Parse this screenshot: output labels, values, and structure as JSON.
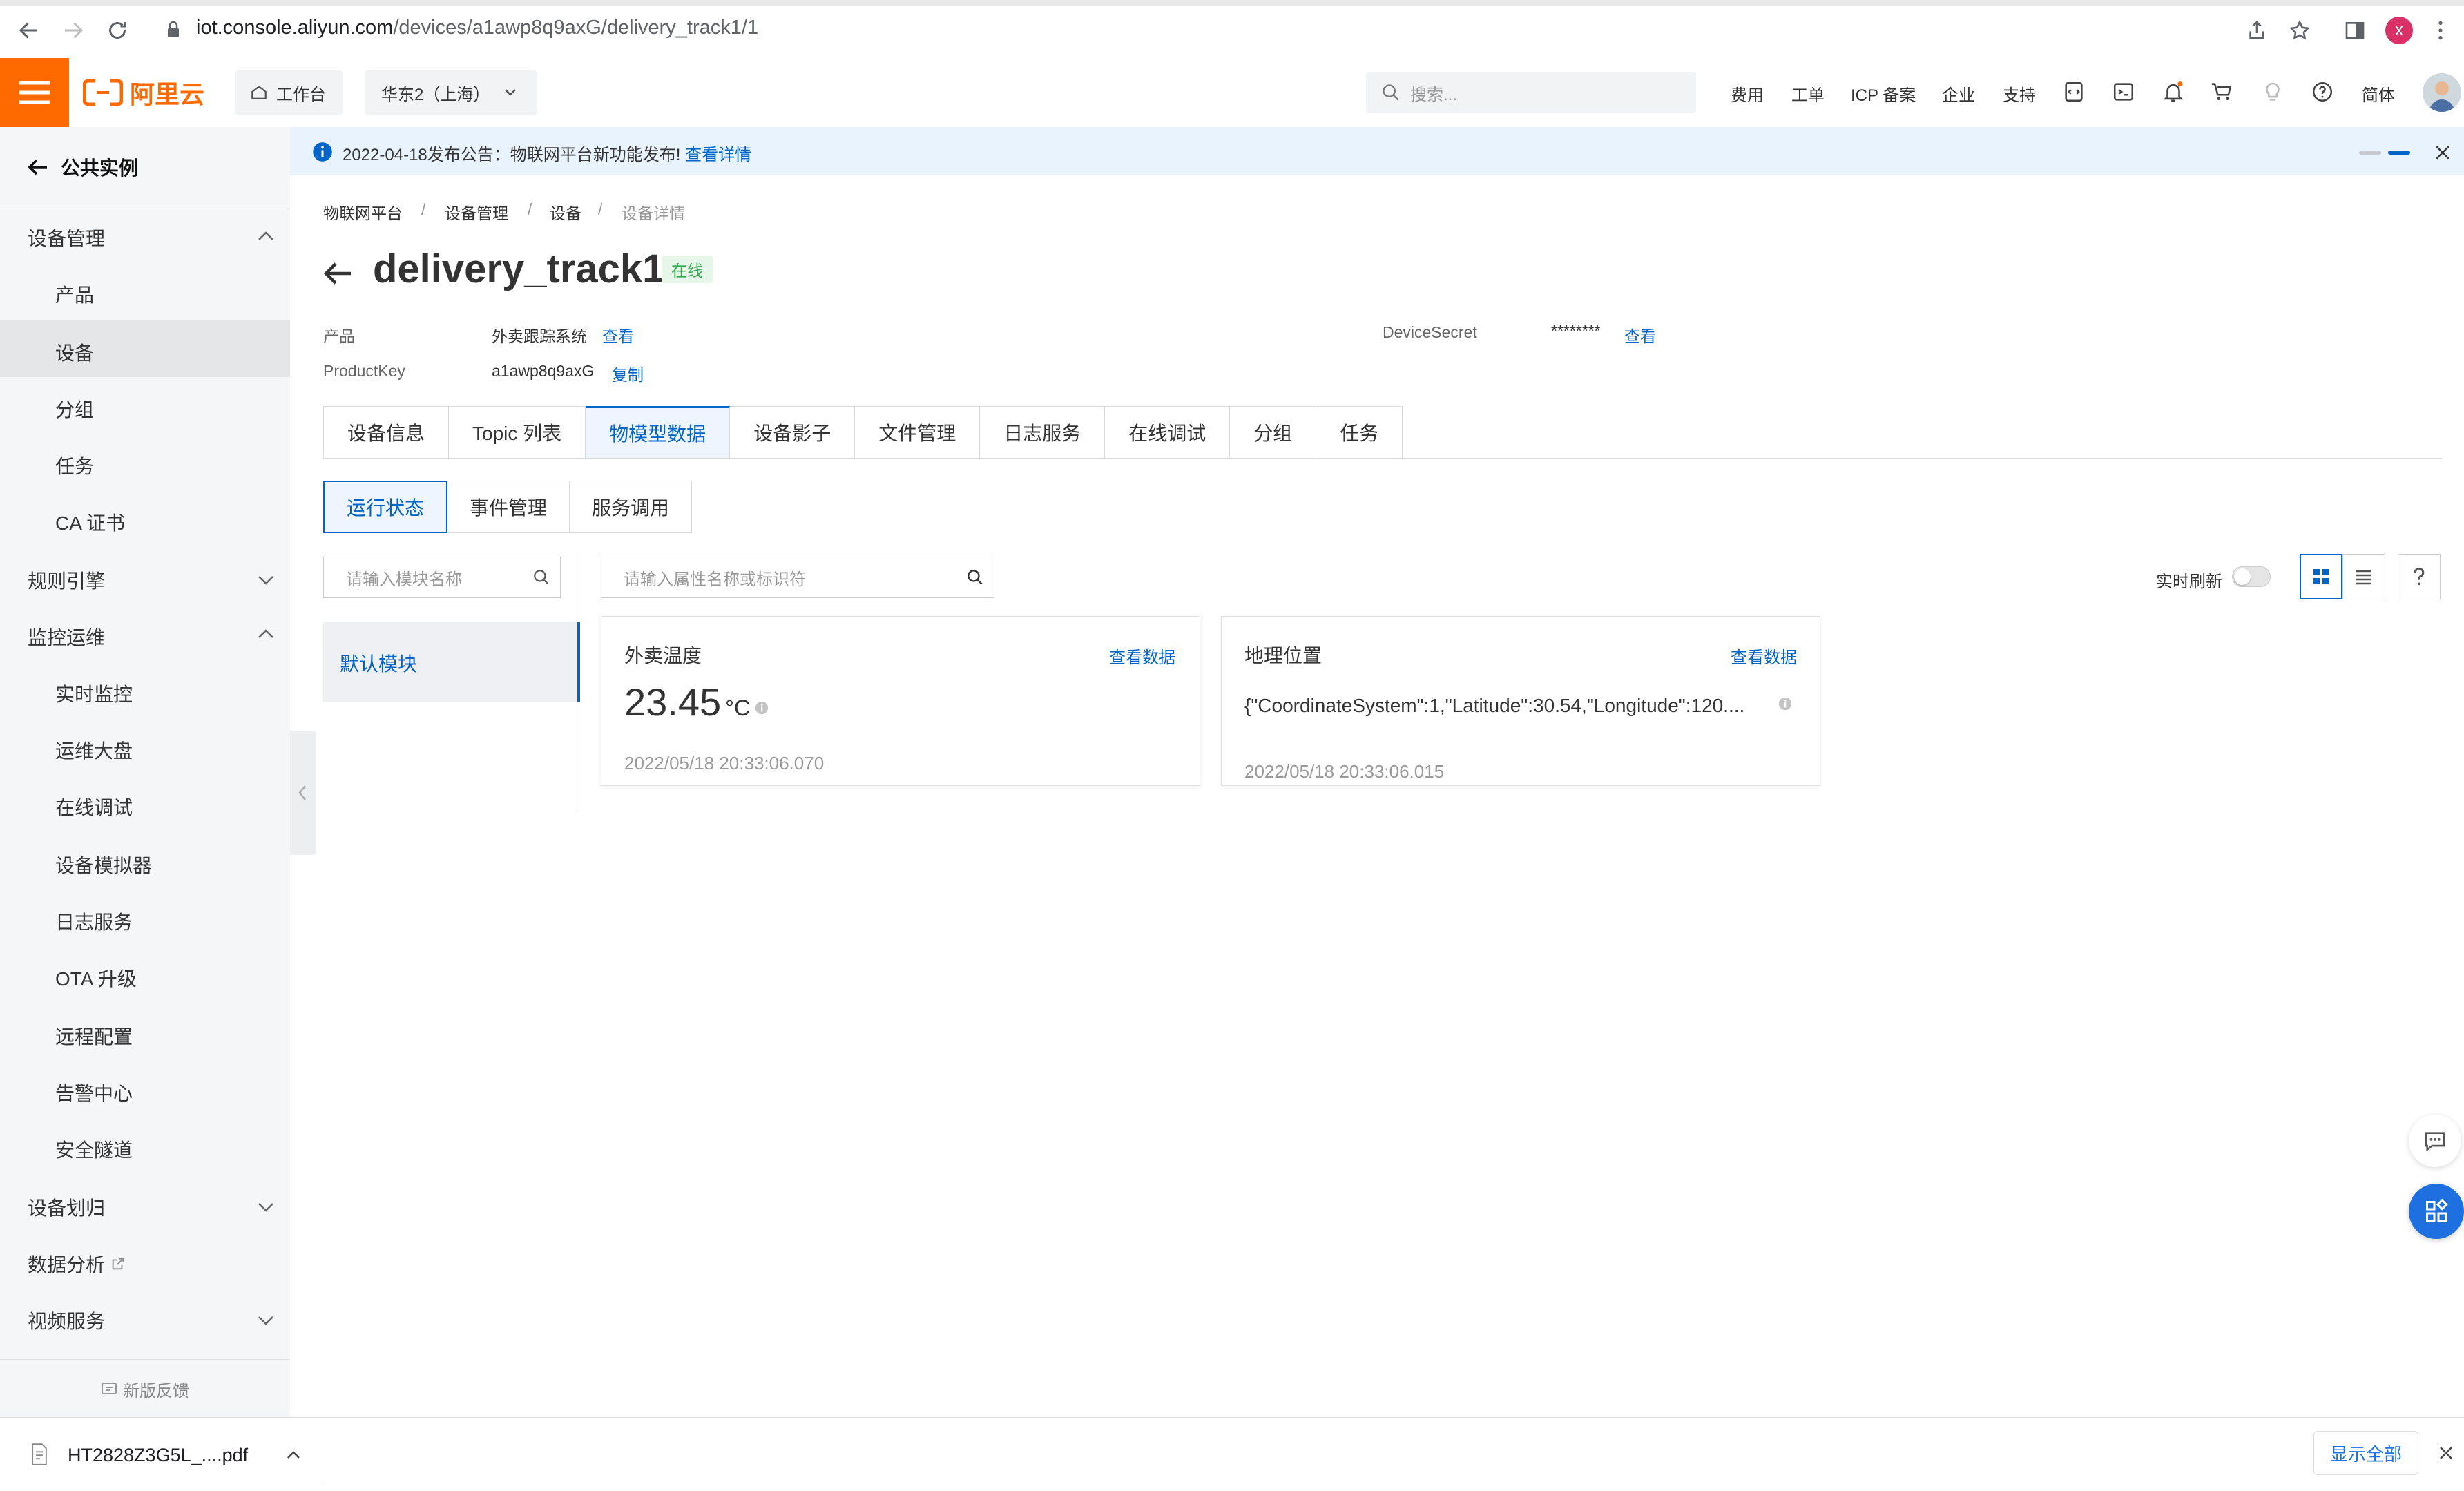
{
  "browser": {
    "url_host": "iot.console.aliyun.com",
    "url_path": "/devices/a1awp8q9axG/delivery_track1/1",
    "profile_initial": "x"
  },
  "header": {
    "logo_text": "阿里云",
    "workbench": "工作台",
    "region": "华东2（上海）",
    "search_placeholder": "搜索...",
    "links": [
      "费用",
      "工单",
      "ICP 备案",
      "企业",
      "支持"
    ],
    "lang": "简体"
  },
  "sidebar": {
    "back_label": "公共实例",
    "groups": [
      {
        "label": "设备管理",
        "expanded": true,
        "items": [
          "产品",
          "设备",
          "分组",
          "任务",
          "CA 证书"
        ],
        "active_item": "设备"
      },
      {
        "label": "规则引擎",
        "expanded": false
      },
      {
        "label": "监控运维",
        "expanded": true,
        "items": [
          "实时监控",
          "运维大盘",
          "在线调试",
          "设备模拟器",
          "日志服务",
          "OTA 升级",
          "远程配置",
          "告警中心",
          "安全隧道"
        ]
      },
      {
        "label": "设备划归",
        "expanded": false
      },
      {
        "label": "数据分析",
        "external": true
      },
      {
        "label": "视频服务",
        "expanded": false
      }
    ],
    "feedback": "新版反馈"
  },
  "announcement": {
    "text": "2022-04-18发布公告：物联网平台新功能发布!",
    "link": "查看详情"
  },
  "breadcrumb": [
    "物联网平台",
    "设备管理",
    "设备",
    "设备详情"
  ],
  "device": {
    "name": "delivery_track1",
    "status": "在线",
    "product_label": "产品",
    "product_value": "外卖跟踪系统",
    "product_link": "查看",
    "productkey_label": "ProductKey",
    "productkey_value": "a1awp8q9axG",
    "productkey_link": "复制",
    "secret_label": "DeviceSecret",
    "secret_value": "********",
    "secret_link": "查看"
  },
  "tabs": [
    "设备信息",
    "Topic 列表",
    "物模型数据",
    "设备影子",
    "文件管理",
    "日志服务",
    "在线调试",
    "分组",
    "任务"
  ],
  "active_tab": "物模型数据",
  "subtabs": [
    "运行状态",
    "事件管理",
    "服务调用"
  ],
  "active_subtab": "运行状态",
  "filters": {
    "module_placeholder": "请输入模块名称",
    "property_placeholder": "请输入属性名称或标识符",
    "realtime_label": "实时刷新",
    "realtime_on": false
  },
  "modules": [
    "默认模块"
  ],
  "cards": [
    {
      "title": "外卖温度",
      "link": "查看数据",
      "value": "23.45",
      "unit": "°C",
      "time": "2022/05/18 20:33:06.070"
    },
    {
      "title": "地理位置",
      "link": "查看数据",
      "value": "{\"CoordinateSystem\":1,\"Latitude\":30.54,\"Longitude\":120....",
      "time": "2022/05/18 20:33:06.015"
    }
  ],
  "downloads": {
    "file": "HT2828Z3G5L_....pdf",
    "show_all": "显示全部"
  },
  "colors": {
    "brand": "#ff6a00",
    "link": "#0064c8",
    "online": "#2fa84f"
  }
}
